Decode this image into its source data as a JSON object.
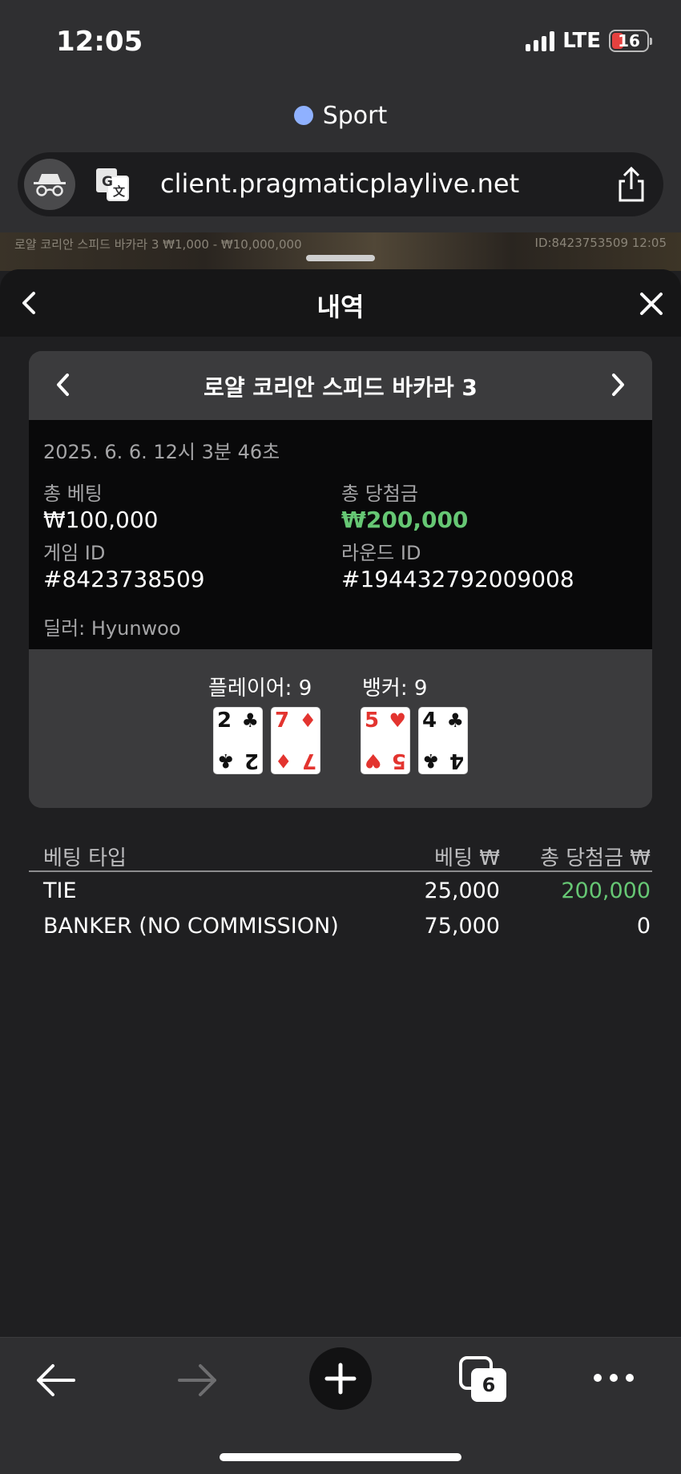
{
  "status_bar": {
    "time": "12:05",
    "network": "LTE",
    "battery": "16"
  },
  "browser": {
    "site_label": "Sport",
    "url": "client.pragmaticplaylive.net",
    "tab_count": "6"
  },
  "game_strip": {
    "left_text": "로얄 코리안 스피드 바카라 3   ₩1,000 - ₩10,000,000",
    "right_text": "ID:8423753509   12:05"
  },
  "sheet": {
    "title": "내역"
  },
  "card": {
    "game_name": "로얄 코리안 스피드 바카라 3",
    "datetime": "2025. 6. 6. 12시 3분 46초",
    "total_bet_label": "총 베팅",
    "total_bet_value": "₩100,000",
    "total_win_label": "총 당첨금",
    "total_win_value": "₩200,000",
    "game_id_label": "게임 ID",
    "game_id_value": "#8423738509",
    "round_id_label": "라운드 ID",
    "round_id_value": "#194432792009008",
    "dealer": "딜러: Hyunwoo",
    "player_label": "플레이어: 9",
    "banker_label": "뱅커: 9",
    "player_cards": [
      {
        "rank": "2",
        "suit": "♣",
        "color": "#111111"
      },
      {
        "rank": "7",
        "suit": "♦",
        "color": "#e3342f"
      }
    ],
    "banker_cards": [
      {
        "rank": "5",
        "suit": "♥",
        "color": "#e3342f"
      },
      {
        "rank": "4",
        "suit": "♣",
        "color": "#111111"
      }
    ]
  },
  "bets_table": {
    "headers": [
      "베팅 타입",
      "베팅 ₩",
      "총 당첨금 ₩"
    ],
    "rows": [
      {
        "type": "TIE",
        "bet": "25,000",
        "win": "200,000"
      },
      {
        "type": "BANKER (NO COMMISSION)",
        "bet": "75,000",
        "win": "0"
      }
    ]
  },
  "colors": {
    "win_green": "#66c774",
    "background": "#1f1f21"
  }
}
